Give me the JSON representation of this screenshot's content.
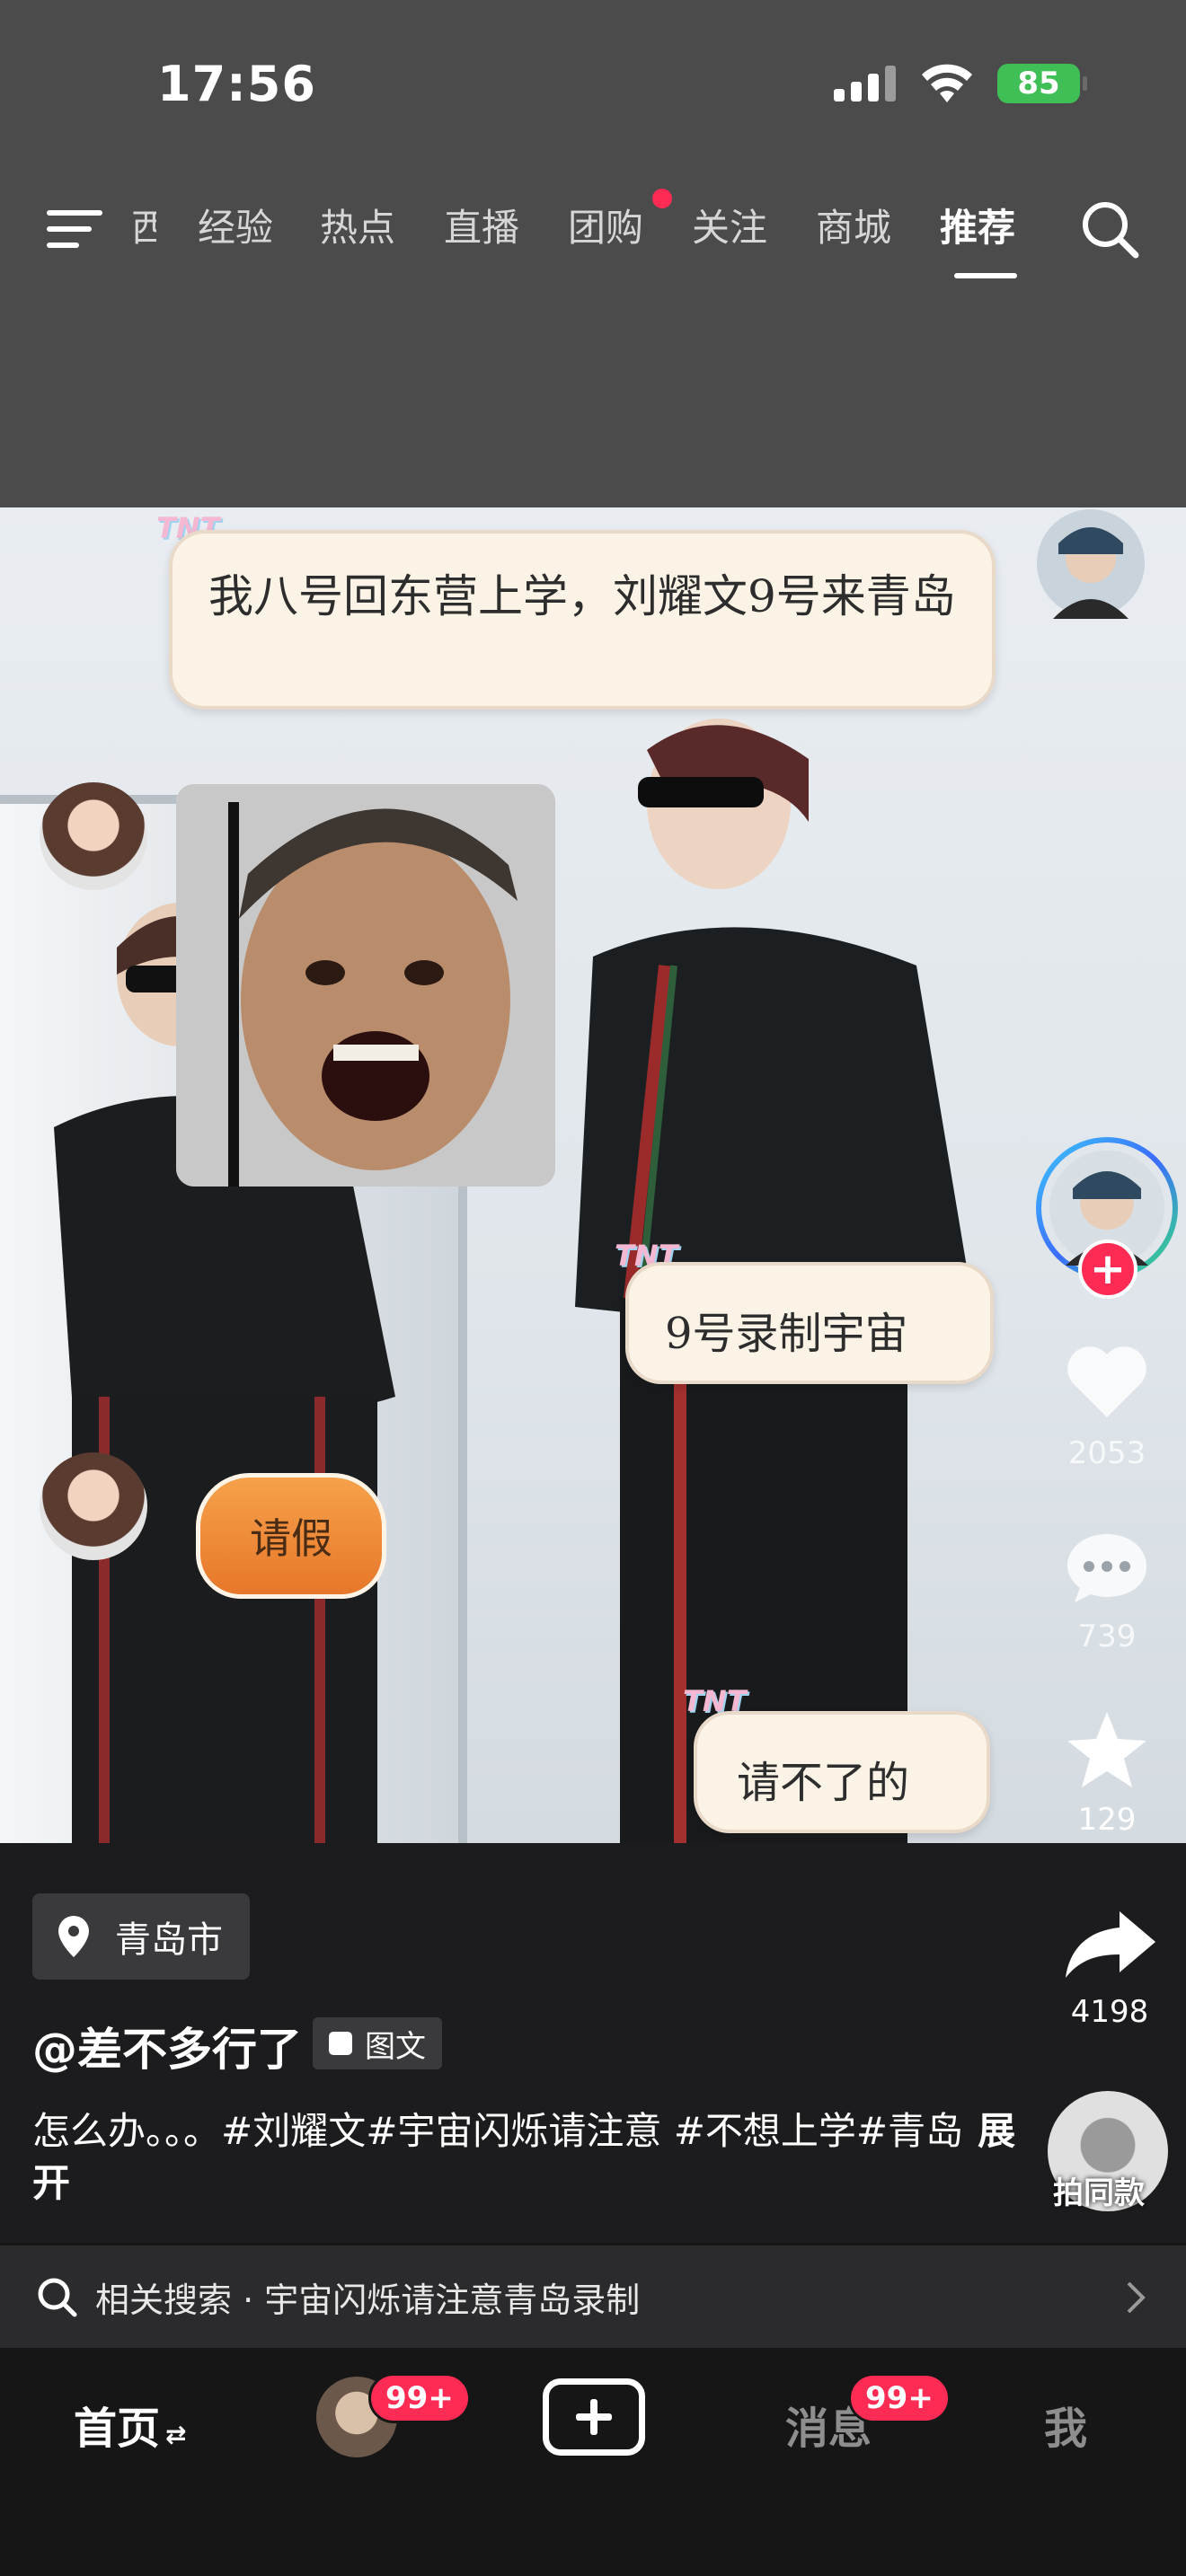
{
  "status_bar": {
    "time": "17:56",
    "battery": "85"
  },
  "top_nav": {
    "partial_tab": "西",
    "tabs": [
      {
        "label": "经验"
      },
      {
        "label": "热点"
      },
      {
        "label": "直播"
      },
      {
        "label": "团购"
      },
      {
        "label": "关注"
      },
      {
        "label": "商城"
      },
      {
        "label": "推荐"
      }
    ],
    "active_tab": "推荐"
  },
  "post": {
    "bubbles": {
      "b1": "我八号回东营上学，刘耀文9号来青岛",
      "b2": "9号录制宇宙",
      "b3": "请不了的"
    },
    "sticker_text": "请假",
    "decoration_tag": "TNT"
  },
  "actions": {
    "likes": "2053",
    "comments": "739",
    "favorites": "129",
    "shares": "4198",
    "music_label": "拍同款"
  },
  "info": {
    "location": "青岛市",
    "username": "@差不多行了",
    "type_label": "图文",
    "caption": "怎么办。。。#刘耀文#宇宙闪烁请注意 #不想上学#青岛",
    "expand": "展开"
  },
  "related_search": {
    "label": "相关搜索 · 宇宙闪烁请注意青岛录制"
  },
  "bottom_nav": {
    "home": "首页",
    "messages": "消息",
    "me": "我",
    "friends_badge": "99+",
    "messages_badge": "99+"
  },
  "colors": {
    "accent": "#fe2c55",
    "battery": "#3fbf55"
  }
}
